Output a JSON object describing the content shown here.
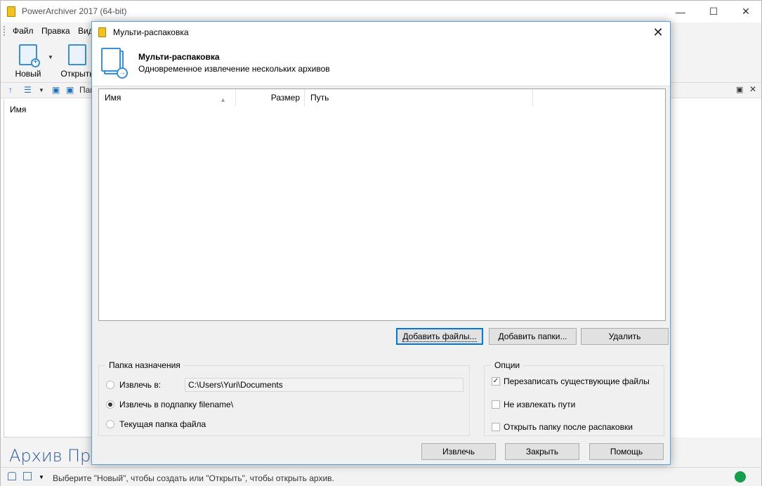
{
  "app": {
    "title": "PowerArchiver 2017 (64-bit)",
    "window_controls": {
      "minimize": "—",
      "maximize": "☐",
      "close": "✕"
    },
    "menu": [
      "Файл",
      "Правка",
      "Вид"
    ],
    "ribbon": {
      "new_label": "Новый",
      "open_label": "Открыть"
    },
    "toolbar2": {
      "panel_label": "Пан"
    },
    "left_pane": {
      "column_name": "Имя"
    },
    "bottom_tabs": [
      "Архив",
      "Про"
    ],
    "status_text": "Выберите \"Новый\", чтобы создать или \"Открыть\", чтобы открыть архив.",
    "status_color": "#14a04a"
  },
  "dialog": {
    "title": "Мульти-распаковка",
    "close": "✕",
    "header_title": "Мульти-распаковка",
    "header_subtitle": "Одновременное извлечение нескольких архивов",
    "columns": {
      "name": "Имя",
      "size": "Размер",
      "path": "Путь"
    },
    "buttons": {
      "add_files": "Добавить файлы...",
      "add_folders": "Добавить папки...",
      "remove": "Удалить",
      "extract": "Извлечь",
      "close": "Закрыть",
      "help": "Помощь"
    },
    "destination": {
      "legend": "Папка назначения",
      "extract_to": "Извлечь в:",
      "path": "C:\\Users\\Yuri\\Documents",
      "subfolder": "Извлечь в подпапку filename\\",
      "current_folder": "Текущая папка файла",
      "selected": "subfolder"
    },
    "options": {
      "legend": "Опции",
      "overwrite": "Перезаписать существующие файлы",
      "overwrite_checked": true,
      "no_paths": "Не извлекать пути",
      "no_paths_checked": false,
      "open_folder": "Открыть папку после распаковки",
      "open_folder_checked": false
    }
  }
}
